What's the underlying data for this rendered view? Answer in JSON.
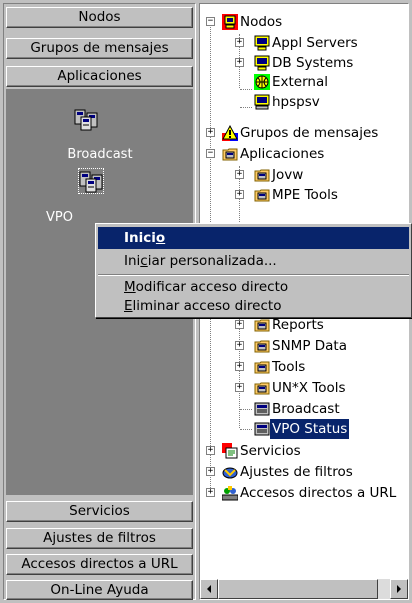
{
  "groups": {
    "top": [
      "Nodos",
      "Grupos de mensajes",
      "Aplicaciones"
    ],
    "bottom": [
      "Servicios",
      "Ajustes de filtros",
      "Accesos directos a URL",
      "On-Line Ayuda"
    ]
  },
  "shortcuts": [
    "Broadcast",
    "VPO"
  ],
  "tree": {
    "nodos": "Nodos",
    "appl_servers": "Appl Servers",
    "db_systems": "DB Systems",
    "external": "External",
    "hpspsv": "hpspsv",
    "grupos": "Grupos de mensajes",
    "aplicaciones": "Aplicaciones",
    "jovw": "Jovw",
    "mpe_tools": "MPE Tools",
    "reports": "Reports",
    "snmp_data": "SNMP Data",
    "tools": "Tools",
    "unix_tools": "UN*X Tools",
    "broadcast": "Broadcast",
    "vpo_status": "VPO Status",
    "servicios": "Servicios",
    "ajustes": "Ajustes de filtros",
    "accesos": "Accesos directos a URL"
  },
  "context_menu": {
    "inicio_pre": "Inici",
    "inicio_ul": "o",
    "iniciar_pre": "Ini",
    "iniciar_ul": "c",
    "iniciar_post": "iar personalizada...",
    "modificar_ul": "M",
    "modificar_post": "odificar acceso directo",
    "eliminar_ul": "E",
    "eliminar_post": "liminar acceso directo"
  },
  "colors": {
    "selection": "#08246b",
    "panel": "#808080",
    "face": "#c0c0c0"
  },
  "icons": {
    "shortcut": "application-group-icon",
    "node": "node-icon",
    "node_group": "node-group-icon",
    "message_group": "warning-triangle-icon",
    "app_group": "application-group-icon",
    "application": "application-icon",
    "services": "services-icon",
    "filters": "filter-icon",
    "url": "url-shortcuts-icon"
  }
}
